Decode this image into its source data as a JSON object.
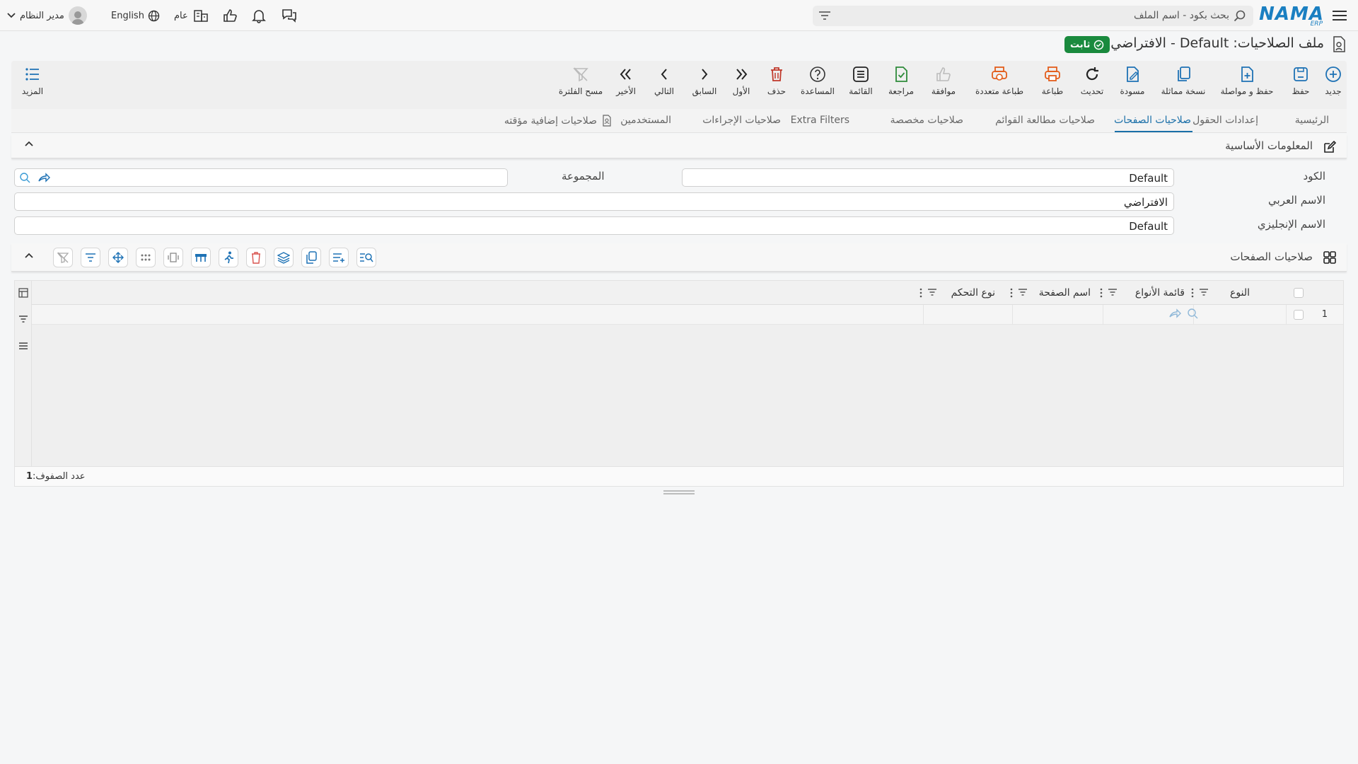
{
  "header": {
    "logo_text": "NAMA",
    "logo_sub": "ERP",
    "search_placeholder": "بحث بكود - اسم الملف",
    "scope_label": "عام",
    "language_label": "English",
    "user_name": "مدير النظام"
  },
  "page": {
    "title": "ملف الصلاحيات: Default - الافتراضي",
    "status_badge": "ثابت"
  },
  "toolbar": {
    "buttons": [
      {
        "label": "جديد",
        "icon": "plus-circle-icon"
      },
      {
        "label": "حفظ",
        "icon": "save-icon"
      },
      {
        "label": "حفظ و مواصلة",
        "icon": "save-continue-icon"
      },
      {
        "label": "نسخة مماثلة",
        "icon": "copy-icon"
      },
      {
        "label": "مسودة",
        "icon": "draft-icon"
      },
      {
        "label": "تحديث",
        "icon": "refresh-icon"
      },
      {
        "label": "طباعة",
        "icon": "print-icon"
      },
      {
        "label": "طباعة متعددة",
        "icon": "multi-print-icon"
      },
      {
        "label": "موافقة",
        "icon": "thumbs-up-icon"
      },
      {
        "label": "مراجعة",
        "icon": "review-icon"
      },
      {
        "label": "القائمة",
        "icon": "list-icon"
      },
      {
        "label": "المساعدة",
        "icon": "help-icon"
      },
      {
        "label": "حذف",
        "icon": "trash-icon"
      },
      {
        "label": "الأول",
        "icon": "first-icon"
      },
      {
        "label": "السابق",
        "icon": "prev-icon"
      },
      {
        "label": "التالي",
        "icon": "next-icon"
      },
      {
        "label": "الأخير",
        "icon": "last-icon"
      },
      {
        "label": "مسح الفلترة",
        "icon": "clear-filter-icon"
      }
    ],
    "more_label": "المزيد"
  },
  "tabs": [
    {
      "label": "الرئيسية"
    },
    {
      "label": "إعدادات الحقول"
    },
    {
      "label": "صلاحيات الصفحات"
    },
    {
      "label": "صلاحيات مطالعة القوائم"
    },
    {
      "label": "صلاحيات مخصصة"
    },
    {
      "label": "Extra Filters"
    },
    {
      "label": "صلاحيات الإجراءات"
    },
    {
      "label": "المستخدمين"
    },
    {
      "label": "صلاحيات إضافية مؤقته"
    }
  ],
  "basic_info": {
    "section_title": "المعلومات الأساسية",
    "code_label": "الكود",
    "code_value": "Default",
    "group_label": "المجموعة",
    "group_value": "",
    "arabic_name_label": "الاسم العربي",
    "arabic_name_value": "الافتراضي",
    "english_name_label": "الاسم الإنجليزي",
    "english_name_value": "Default"
  },
  "page_permissions": {
    "section_title": "صلاحيات الصفحات",
    "columns": [
      "النوع",
      "قائمة الأنواع",
      "اسم الصفحة",
      "نوع التحكم"
    ],
    "rows": [
      {
        "num": "1",
        "type": "",
        "type_list": "",
        "page_name": "",
        "control_type": ""
      }
    ],
    "row_count_label": "عدد الصفوف:",
    "row_count": "1"
  }
}
